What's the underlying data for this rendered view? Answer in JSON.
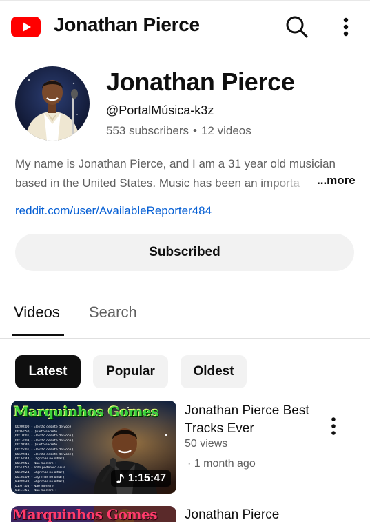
{
  "header": {
    "app_title": "Jonathan Pierce",
    "logo_icon": "youtube-logo-icon",
    "search_icon": "search-icon",
    "more_icon": "more-vertical-icon",
    "brand_color": "#ff0000"
  },
  "channel": {
    "name": "Jonathan Pierce",
    "handle": "@PortalMúsica-k3z",
    "subscribers": "553 subscribers",
    "separator": "•",
    "videos": "12 videos",
    "description_line1": "My name is Jonathan Pierce, and I am a 31 year old musician",
    "description_line2": "based in the United States. Music has been an importa",
    "more_label": "...more",
    "link": "reddit.com/user/AvailableReporter484",
    "subscribe_label": "Subscribed"
  },
  "tabs": [
    {
      "label": "Videos",
      "active": true
    },
    {
      "label": "Search",
      "active": false
    }
  ],
  "filters": [
    {
      "label": "Latest",
      "selected": true
    },
    {
      "label": "Popular",
      "selected": false
    },
    {
      "label": "Oldest",
      "selected": false
    }
  ],
  "videos": [
    {
      "thumbnail_text": "Marquinhos Gomes",
      "duration": "1:15:47",
      "title": "Jonathan Pierce Best Tracks Ever",
      "views": "50 views",
      "age": "· 1 month ago",
      "tracklist": [
        "[00:00:00] - Ele não desiste de você",
        "[00:04:50] - Quarto secreto",
        "[00:10:01] - Ele não desiste de você (",
        "[00:14:08] - Ele não desiste de você (",
        "[00:20:40] - Quarto secreto",
        "[00:25:01] - Ele não desiste de você (",
        "[00:29:41] - Ele não desiste de você (",
        "[00:34:44] - Lágrimas no olhar (",
        "[00:39:55] - Não morrerei (",
        "[00:43:52] - Todo poderoso deus",
        "[00:49:24] - Lágrimas no olhar (",
        "[00:54:09] - Lágrimas no olhar (",
        "[01:00:30] - Lágrimas no olhar (",
        "[01:07:05] - Não morrerei",
        "[01:11:55] - Não morrerei ("
      ]
    },
    {
      "thumbnail_text": "Marquinhos Gomes",
      "title": "Jonathan Pierce"
    }
  ]
}
